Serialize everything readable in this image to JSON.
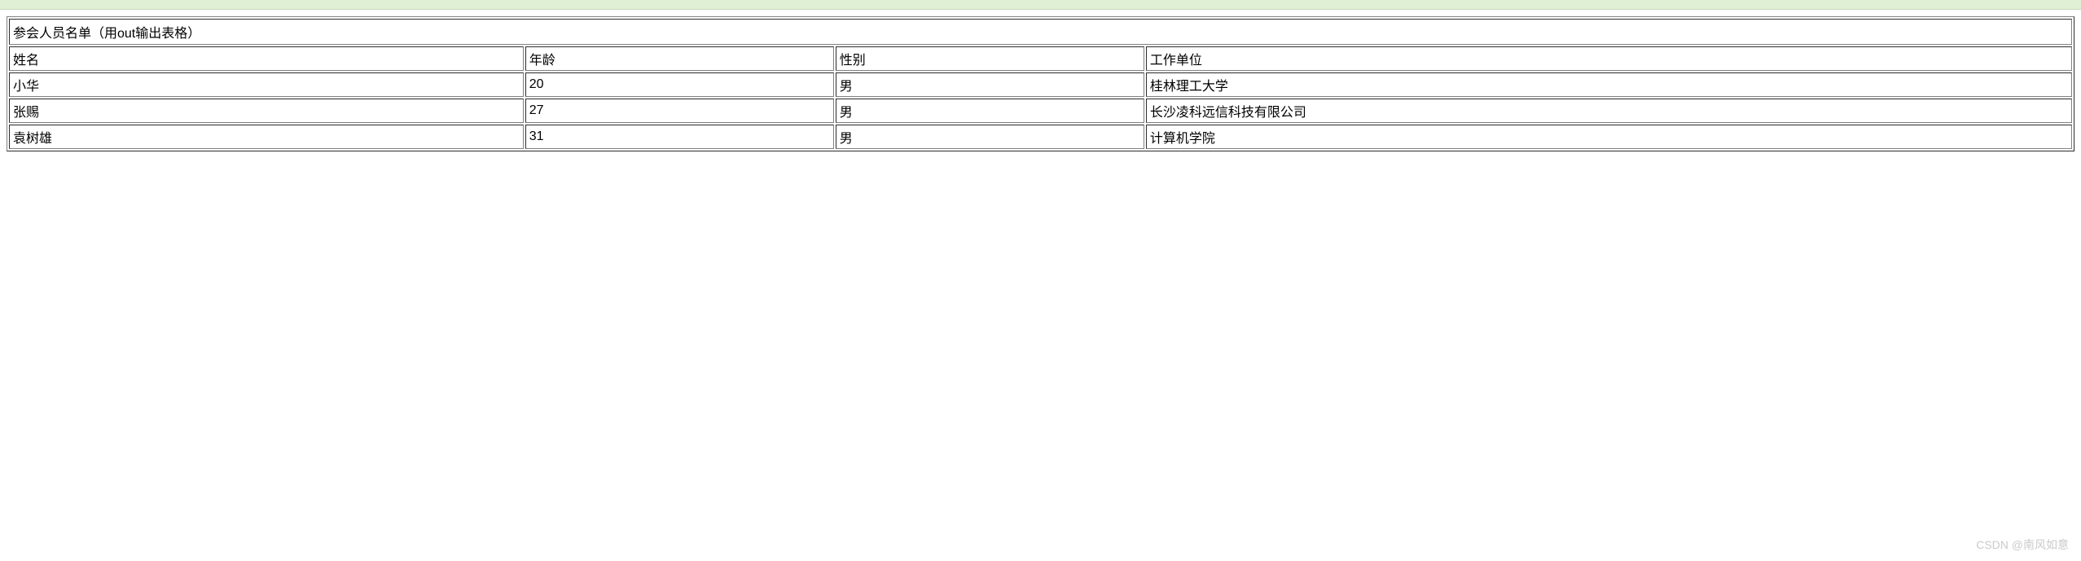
{
  "caption": "参会人员名单（用out输出表格）",
  "headers": {
    "name": "姓名",
    "age": "年龄",
    "gender": "性别",
    "org": "工作单位"
  },
  "rows": [
    {
      "name": "小华",
      "age": "20",
      "gender": "男",
      "org": "桂林理工大学"
    },
    {
      "name": "张赐",
      "age": "27",
      "gender": "男",
      "org": "长沙凌科远信科技有限公司"
    },
    {
      "name": "袁树雄",
      "age": "31",
      "gender": "男",
      "org": "计算机学院"
    }
  ],
  "watermark": "CSDN @南风如意"
}
